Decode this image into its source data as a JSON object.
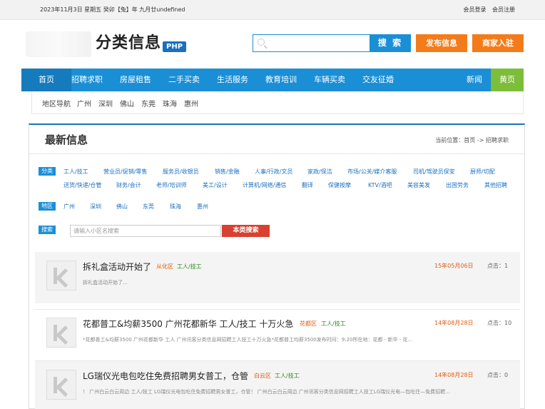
{
  "topbar": {
    "date": "2023年11月3日 星期五  癸卯【兔】年 九月廿undefined",
    "login": "会员登录",
    "register": "会员注册"
  },
  "header": {
    "logo_text": "分类信息",
    "logo_badge": "PHP",
    "search_placeholder": "",
    "search_button": "搜 索",
    "post_button": "发布信息",
    "merchant_button": "商家入驻"
  },
  "nav": {
    "items": [
      "首页",
      "招聘求职",
      "房屋租售",
      "二手买卖",
      "生活服务",
      "教育培训",
      "车辆买卖",
      "交友征婚"
    ],
    "news": "新闻",
    "yellow_pages": "黄页"
  },
  "region_bar": {
    "label": "地区导航",
    "cities": [
      "广州",
      "深圳",
      "佛山",
      "东莞",
      "珠海",
      "惠州"
    ]
  },
  "panel": {
    "title": "最新信息",
    "breadcrumb": "当前位置：首页 -> 招聘求职"
  },
  "filters": {
    "category_tag": "分类",
    "categories_row1": [
      "工人/技工",
      "营业员/促销/零售",
      "服务员/收银员",
      "销售/金融",
      "人事/行政/文员",
      "家政/保洁",
      "市场/公关/媒介客服",
      "司机/驾驶员保安",
      "厨师/切配"
    ],
    "categories_row2": [
      "送货/快递/仓管",
      "财务/会计",
      "老师/培训师",
      "美工/设计",
      "计算机/网络/通信",
      "翻译",
      "保健按摩",
      "KTV/酒吧",
      "美容美发",
      "出国劳务",
      "其他招聘"
    ],
    "region_tag": "地区",
    "regions": [
      "广州",
      "深圳",
      "佛山",
      "东莞",
      "珠海",
      "惠州"
    ],
    "search_tag": "搜索",
    "keyword_placeholder": "请输入小区名搜索",
    "keyword_button": "本类搜索"
  },
  "listings": [
    {
      "title": "拆礼盒活动开始了",
      "area": "从化区",
      "category": "工人/技工",
      "date": "15年05月06日",
      "hits": "点击：1",
      "desc": "拆礼盒活动开始了..."
    },
    {
      "title": "花都普工&均薪3500 广州花都新华 工人/技工 十万火急",
      "area": "花都区",
      "category": "工人/技工",
      "date": "14年08月28日",
      "hits": "点击：10",
      "desc": "*花都普工&均薪3500 广州花都新华 工人 广州讯客分类信息网招聘工人技工十万火急*花都普工均薪3500发布时间：9:20所在地：花都 - 新华 - 花..."
    },
    {
      "title": "LG瑞仪光电包吃住免费招聘男女普工，仓管",
      "area": "白云区",
      "category": "工人/技工",
      "date": "14年08月28日",
      "hits": "点击：0",
      "desc": "！ 广州白云白云周边 工人/技工 LG瑞仪光电包吃住免费招聘男女普工，仓管！ 广州白云白云周边 广州讯客分类信息网招聘工人技工LG瑞仪光电—包吃住—免费招聘..."
    }
  ]
}
